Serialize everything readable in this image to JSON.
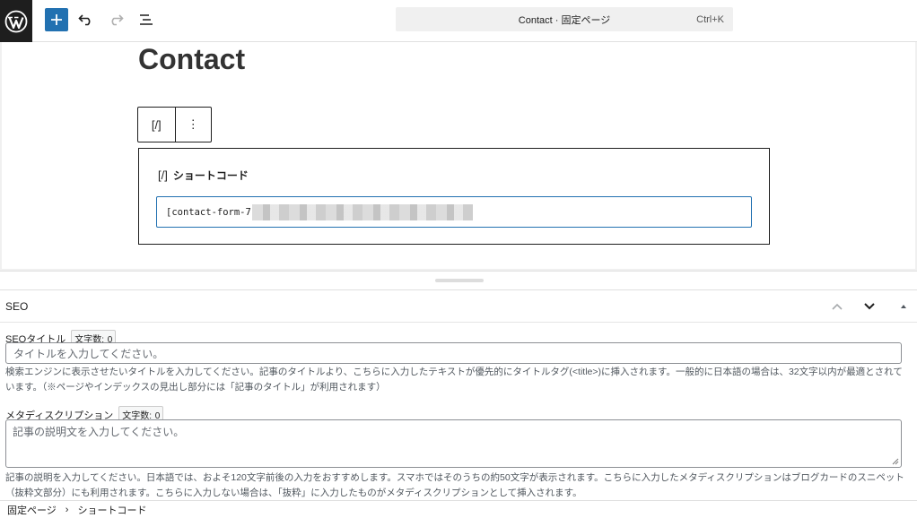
{
  "toolbar": {
    "command_title": "Contact · 固定ページ",
    "command_shortcut": "Ctrl+K"
  },
  "editor": {
    "page_title": "Contact",
    "block_toolbar": {
      "block_icon": "[/]",
      "options_icon": "⋮"
    },
    "shortcode_block": {
      "icon": "[/]",
      "label": "ショートコード",
      "value_visible": "[contact-form-7"
    }
  },
  "metabox": {
    "title": "SEO",
    "seo_title": {
      "label": "SEOタイトル",
      "count_label": "文字数:",
      "count": "0",
      "placeholder": "タイトルを入力してください。",
      "help": "検索エンジンに表示させたいタイトルを入力してください。記事のタイトルより、こちらに入力したテキストが優先的にタイトルタグ(<title>)に挿入されます。一般的に日本語の場合は、32文字以内が最適とされています。（※ページやインデックスの見出し部分には「記事のタイトル」が利用されます）"
    },
    "meta_description": {
      "label": "メタディスクリプション",
      "count_label": "文字数:",
      "count": "0",
      "placeholder": "記事の説明文を入力してください。",
      "help": "記事の説明を入力してください。日本語では、およそ120文字前後の入力をおすすめします。スマホではそのうちの約50文字が表示されます。こちらに入力したメタディスクリプションはブログカードのスニペット（抜粋文部分）にも利用されます。こちらに入力しない場合は、「抜粋」に入力したものがメタディスクリプションとして挿入されます。"
    }
  },
  "breadcrumb": {
    "items": [
      "固定ページ",
      "ショートコード"
    ],
    "separator": "›"
  },
  "colors": {
    "accent": "#2271b1",
    "dark": "#1e1e1e"
  }
}
